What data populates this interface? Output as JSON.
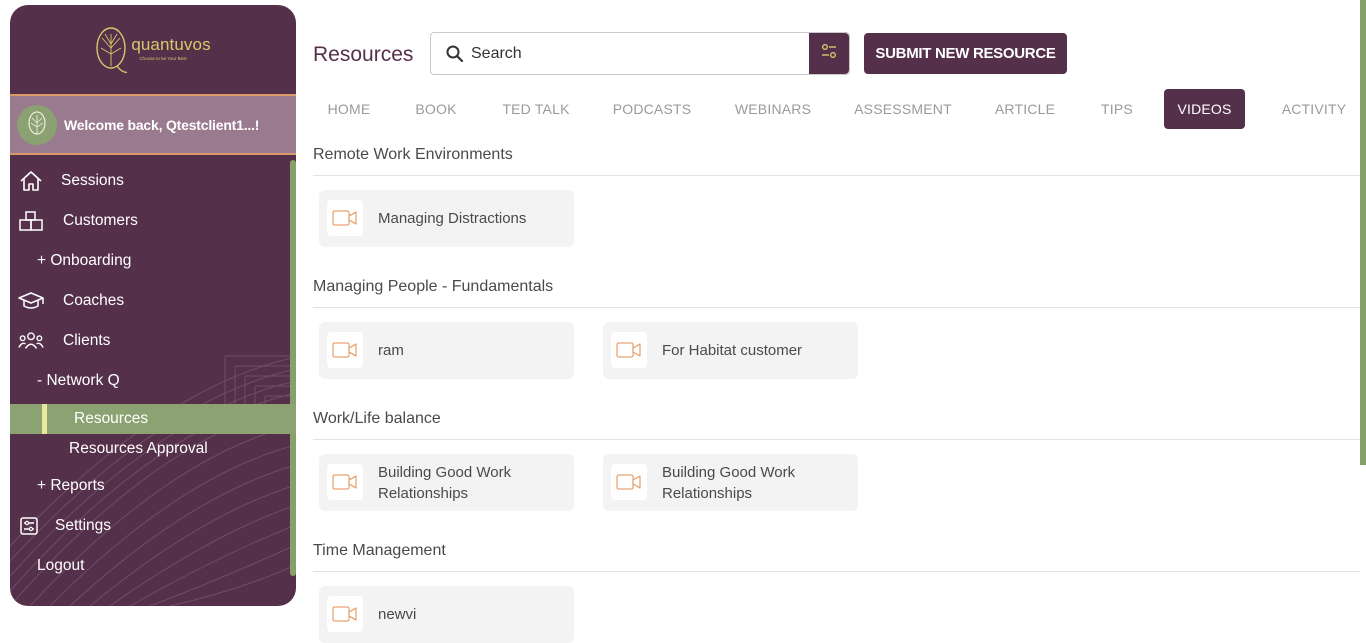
{
  "brand": {
    "name": "quantuvos",
    "tagline": "Choose to be Your Best",
    "primary_color": "#55304b",
    "accent_color": "#8da272",
    "highlight_color": "#d99a66"
  },
  "sidebar": {
    "welcome": "Welcome back, Qtestclient1...!",
    "items": [
      {
        "label": "Sessions",
        "icon": "home-icon"
      },
      {
        "label": "Customers",
        "icon": "boxes-icon"
      },
      {
        "label": "+ Onboarding",
        "icon": ""
      },
      {
        "label": "Coaches",
        "icon": "graduation-cap-icon"
      },
      {
        "label": "Clients",
        "icon": "users-icon"
      },
      {
        "label": "- Network Q",
        "icon": ""
      },
      {
        "label": "Resources",
        "icon": "",
        "active": true
      },
      {
        "label": "Resources Approval",
        "icon": ""
      },
      {
        "label": "+ Reports",
        "icon": ""
      },
      {
        "label": "Settings",
        "icon": "settings-sliders-icon"
      },
      {
        "label": "Logout",
        "icon": ""
      }
    ]
  },
  "header": {
    "title": "Resources",
    "search_placeholder": "Search",
    "submit_label": "SUBMIT NEW RESOURCE"
  },
  "tabs": [
    {
      "label": "HOME"
    },
    {
      "label": "BOOK"
    },
    {
      "label": "TED TALK"
    },
    {
      "label": "PODCASTS"
    },
    {
      "label": "WEBINARS"
    },
    {
      "label": "ASSESSMENT"
    },
    {
      "label": "ARTICLE"
    },
    {
      "label": "TIPS"
    },
    {
      "label": "VIDEOS",
      "active": true
    },
    {
      "label": "ACTIVITY"
    }
  ],
  "sections": [
    {
      "title": "Remote Work Environments",
      "items": [
        {
          "title": "Managing Distractions"
        }
      ]
    },
    {
      "title": "Managing People - Fundamentals",
      "items": [
        {
          "title": "ram"
        },
        {
          "title": "For Habitat customer"
        }
      ]
    },
    {
      "title": "Work/Life balance",
      "items": [
        {
          "title": "Building Good Work Relationships"
        },
        {
          "title": "Building Good Work Relationships"
        }
      ]
    },
    {
      "title": "Time Management",
      "items": [
        {
          "title": "newvi"
        }
      ]
    }
  ]
}
